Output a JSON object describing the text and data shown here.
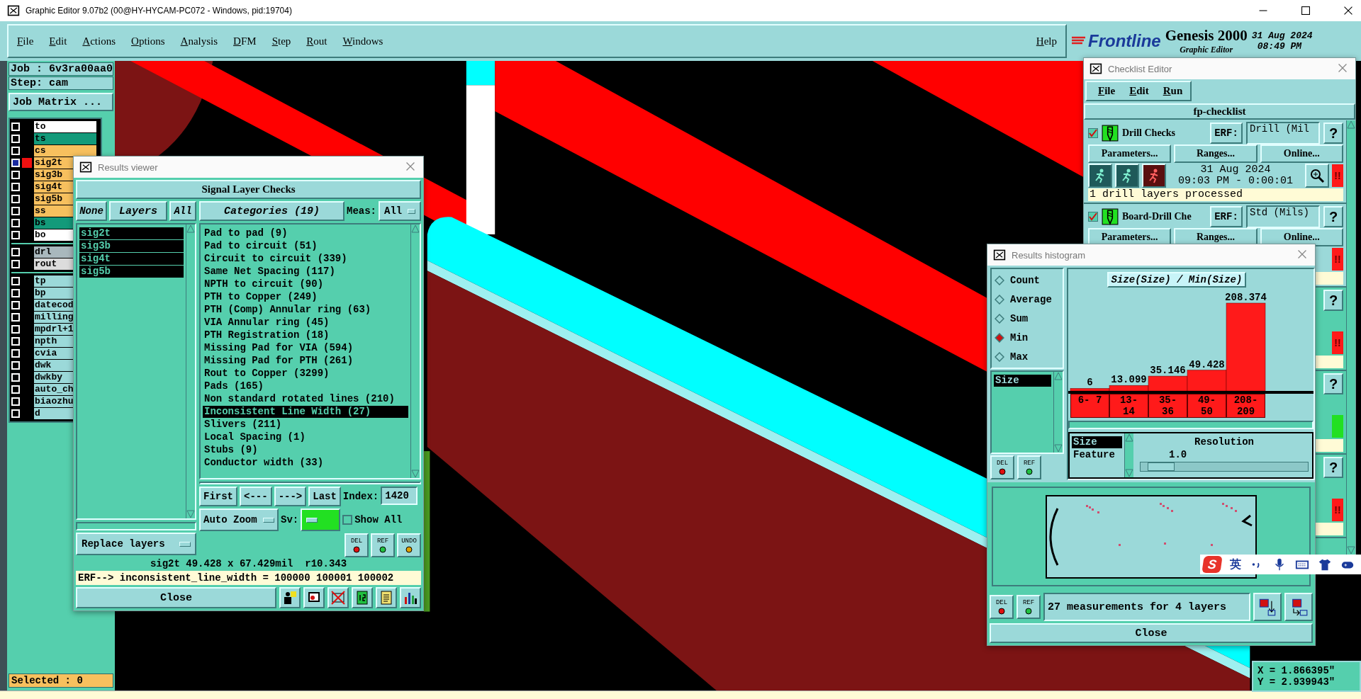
{
  "app_title": "Graphic Editor 9.07b2 (00@HY-HYCAM-PC072 - Windows, pid:19704)",
  "menu": [
    "File",
    "Edit",
    "Actions",
    "Options",
    "Analysis",
    "DFM",
    "Step",
    "Rout",
    "Windows"
  ],
  "help": "Help",
  "brand": {
    "logo": "Frontline",
    "product": "Genesis 2000",
    "subtitle": "Graphic Editor",
    "date": "31 Aug 2024",
    "time": "08:49 PM"
  },
  "job_panel": {
    "job": "Job : 6v3ra00aa0",
    "step": "Step: cam",
    "matrix_button": "Job Matrix ...",
    "layer_groups": [
      {
        "layers": [
          {
            "name": "to",
            "color": "#ffffff",
            "checked": false,
            "active": false
          },
          {
            "name": "ts",
            "color": "#139a7a",
            "checked": false,
            "active": false
          },
          {
            "name": "cs",
            "color": "#f7c05e",
            "checked": false,
            "active": false
          },
          {
            "name": "sig2t",
            "color": "#f7c05e",
            "checked": true,
            "active": true
          },
          {
            "name": "sig3b",
            "color": "#f7c05e",
            "checked": false,
            "active": false
          },
          {
            "name": "sig4t",
            "color": "#f7c05e",
            "checked": false,
            "active": false
          },
          {
            "name": "sig5b",
            "color": "#f7c05e",
            "checked": false,
            "active": false
          },
          {
            "name": "ss",
            "color": "#f7c05e",
            "checked": false,
            "active": false
          },
          {
            "name": "bs",
            "color": "#139a7a",
            "checked": false,
            "active": false
          },
          {
            "name": "bo",
            "color": "#ffffff",
            "checked": false,
            "active": false
          }
        ]
      },
      {
        "layers": [
          {
            "name": "drl",
            "color": "#a9b8bd",
            "checked": false,
            "active": false
          },
          {
            "name": "rout",
            "color": "#dcdcdc",
            "checked": false,
            "active": false
          }
        ]
      },
      {
        "layers": [
          {
            "name": "tp",
            "color": "#9bd9d9",
            "checked": false,
            "active": false
          },
          {
            "name": "bp",
            "color": "#9bd9d9",
            "checked": false,
            "active": false
          },
          {
            "name": "datecod",
            "color": "#9bd9d9",
            "checked": false,
            "active": false
          },
          {
            "name": "milling",
            "color": "#9bd9d9",
            "checked": false,
            "active": false
          },
          {
            "name": "mpdrl+1",
            "color": "#9bd9d9",
            "checked": false,
            "active": false
          },
          {
            "name": "npth",
            "color": "#9bd9d9",
            "checked": false,
            "active": false
          },
          {
            "name": "cvia",
            "color": "#9bd9d9",
            "checked": false,
            "active": false
          },
          {
            "name": "dwk",
            "color": "#9bd9d9",
            "checked": false,
            "active": false
          },
          {
            "name": "dwkby",
            "color": "#9bd9d9",
            "checked": false,
            "active": false
          },
          {
            "name": "auto_ch",
            "color": "#9bd9d9",
            "checked": false,
            "active": false
          },
          {
            "name": "biaozhu",
            "color": "#9bd9d9",
            "checked": false,
            "active": false
          },
          {
            "name": "d",
            "color": "#9bd9d9",
            "checked": false,
            "active": false
          }
        ]
      }
    ],
    "selected_count": "Selected : 0"
  },
  "results_viewer": {
    "title": "Results viewer",
    "header": "Signal Layer Checks",
    "none_button": "None",
    "layers_label": "Layers",
    "all_button": "All",
    "layers": [
      {
        "name": "sig2t",
        "selected": true
      },
      {
        "name": "sig3b",
        "selected": true
      },
      {
        "name": "sig4t",
        "selected": true
      },
      {
        "name": "sig5b",
        "selected": true
      }
    ],
    "categories_button": "Categories (19)",
    "meas_label": "Meas:",
    "meas_value": "All",
    "categories": [
      {
        "label": "Pad to pad (9)",
        "selected": false
      },
      {
        "label": "Pad to circuit (51)",
        "selected": false
      },
      {
        "label": "Circuit to circuit (339)",
        "selected": false
      },
      {
        "label": "Same Net Spacing (117)",
        "selected": false
      },
      {
        "label": "NPTH to circuit (90)",
        "selected": false
      },
      {
        "label": "PTH to Copper (249)",
        "selected": false
      },
      {
        "label": "PTH (Comp) Annular ring (63)",
        "selected": false
      },
      {
        "label": "VIA Annular ring (45)",
        "selected": false
      },
      {
        "label": "PTH Registration (18)",
        "selected": false
      },
      {
        "label": "Missing Pad for VIA (594)",
        "selected": false
      },
      {
        "label": "Missing Pad for PTH (261)",
        "selected": false
      },
      {
        "label": "Rout to Copper (3299)",
        "selected": false
      },
      {
        "label": "Pads (165)",
        "selected": false
      },
      {
        "label": "Non standard rotated lines (210)",
        "selected": false
      },
      {
        "label": "Inconsistent Line Width (27)",
        "selected": true
      },
      {
        "label": "Slivers (211)",
        "selected": false
      },
      {
        "label": "Local Spacing (1)",
        "selected": false
      },
      {
        "label": "Stubs (9)",
        "selected": false
      },
      {
        "label": "Conductor width (33)",
        "selected": false
      }
    ],
    "nav": [
      "First",
      "<---",
      "--->",
      "Last"
    ],
    "index_label": "Index:",
    "index_value": "1420",
    "zoom_mode": "Auto Zoom",
    "sv_label": "Sv:",
    "show_all": {
      "label": "Show All",
      "checked": false
    },
    "replace_mode": "Replace layers",
    "action_buttons": [
      "DEL",
      "REF",
      "UNDO"
    ],
    "measurement": "sig2t 49.428 x 67.429mil  r10.343",
    "erf_line": "ERF--> inconsistent_line_width = 100000 100001 100002",
    "close": "Close"
  },
  "checklist": {
    "title": "Checklist Editor",
    "menu": [
      "File",
      "Edit",
      "Run"
    ],
    "name": "fp-checklist",
    "checks": [
      {
        "kind": "full",
        "name": "Drill Checks",
        "checked": true,
        "erf_label": "ERF:",
        "erf_value": "Drill (Mil",
        "help": "?",
        "buttons": [
          "Parameters...",
          "Ranges...",
          "Online..."
        ],
        "date": "31 Aug 2024",
        "time": "09:03 PM - 0:00:01",
        "passed": false,
        "mark": "!!",
        "message": "1 drill layers processed"
      },
      {
        "kind": "full",
        "name": "Board-Drill Che",
        "checked": true,
        "erf_label": "ERF:",
        "erf_value": "Std (Mils)",
        "help": "?",
        "buttons": [
          "Parameters...",
          "Ranges...",
          "Online..."
        ],
        "passed": false,
        "mark": "!!"
      },
      {
        "kind": "peek",
        "help": "?",
        "passed": false,
        "mark": "!!"
      },
      {
        "kind": "peek",
        "help": "?",
        "passed": true
      },
      {
        "kind": "peek",
        "help": "?",
        "passed": false,
        "mark": "!!"
      }
    ]
  },
  "histogram": {
    "title": "Results histogram",
    "modes": [
      {
        "label": "Count",
        "selected": false
      },
      {
        "label": "Average",
        "selected": false
      },
      {
        "label": "Sum",
        "selected": false
      },
      {
        "label": "Min",
        "selected": true
      },
      {
        "label": "Max",
        "selected": false
      }
    ],
    "fields": [
      {
        "label": "Size",
        "selected": true
      }
    ],
    "list_buttons": [
      "DEL",
      "REF"
    ],
    "chart_data": {
      "type": "bar",
      "title": "Size(Size) / Min(Size)",
      "categories": [
        "6- 7",
        "13- 14",
        "35- 36",
        "49- 50",
        "208- 209"
      ],
      "values": [
        6,
        13.099,
        35.146,
        49.428,
        208.374
      ],
      "value_labels": [
        "6",
        "13.099",
        "35.146",
        "49.428",
        "208.374"
      ]
    },
    "sort_fields": [
      {
        "label": "Size",
        "selected": true
      },
      {
        "label": "Feature",
        "selected": false
      }
    ],
    "resolution": {
      "label": "Resolution",
      "value": "1.0",
      "level": 0.12
    },
    "preview_buttons": [
      "DEL",
      "REF"
    ],
    "summary": "27 measurements for 4 layers",
    "close": "Close"
  },
  "coords": {
    "x": "X = 1.866395\"",
    "y": "Y = 2.939943\""
  },
  "ime": {
    "logo": "S",
    "lang": "英"
  }
}
